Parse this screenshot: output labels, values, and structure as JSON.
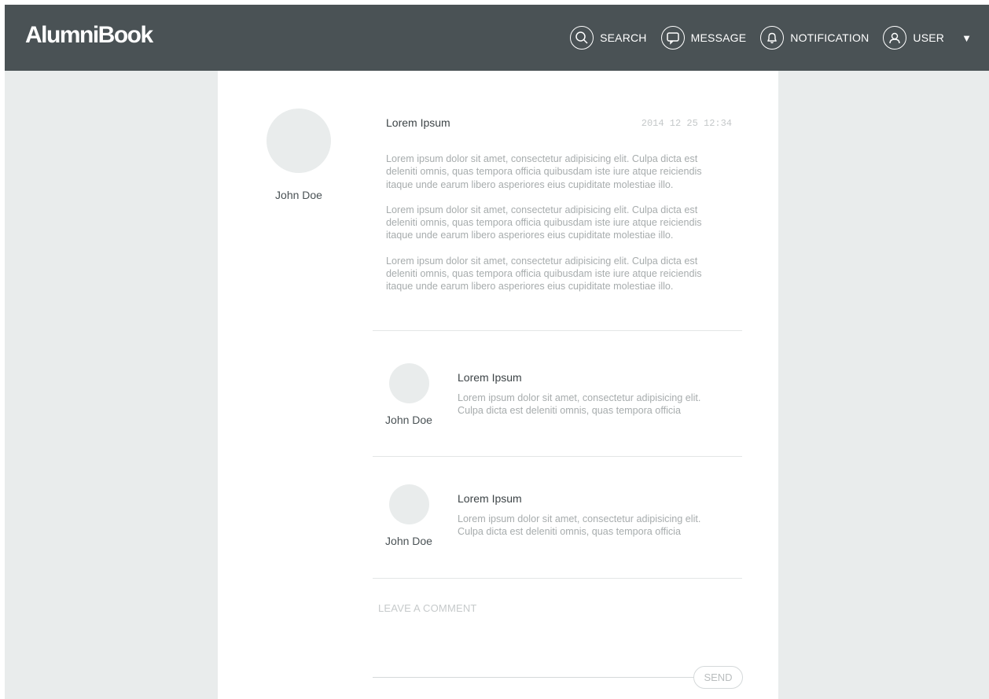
{
  "app": {
    "logo": "AlumniBook"
  },
  "nav": {
    "items": [
      {
        "label": "SEARCH",
        "icon": "search-icon"
      },
      {
        "label": "MESSAGE",
        "icon": "message-icon"
      },
      {
        "label": "NOTIFICATION",
        "icon": "bell-icon"
      },
      {
        "label": "USER",
        "icon": "user-icon"
      }
    ],
    "dropdown_icon": "caret-down-icon"
  },
  "post": {
    "author": "John Doe",
    "title": "Lorem Ipsum",
    "timestamp": "2014 12 25 12:34",
    "paragraphs": [
      [
        "Lorem ipsum dolor sit amet, consectetur adipisicing elit. Culpa dicta est",
        "deleniti omnis, quas tempora officia quibusdam iste iure atque reiciendis",
        "itaque unde earum libero asperiores eius cupiditate molestiae illo."
      ],
      [
        "Lorem ipsum dolor sit amet, consectetur adipisicing elit. Culpa dicta est",
        "deleniti omnis, quas tempora officia quibusdam iste iure atque reiciendis",
        "itaque unde earum libero asperiores eius cupiditate molestiae illo."
      ],
      [
        "Lorem ipsum dolor sit amet, consectetur adipisicing elit. Culpa dicta est",
        "deleniti omnis, quas tempora officia quibusdam iste iure atque reiciendis",
        "itaque unde earum libero asperiores eius cupiditate molestiae illo."
      ]
    ]
  },
  "comments": [
    {
      "author": "John Doe",
      "title": "Lorem Ipsum",
      "lines": [
        "Lorem ipsum dolor sit amet, consectetur adipisicing elit.",
        "Culpa dicta est deleniti omnis, quas tempora officia"
      ]
    },
    {
      "author": "John Doe",
      "title": "Lorem Ipsum",
      "lines": [
        "Lorem ipsum dolor sit amet, consectetur adipisicing elit.",
        "Culpa dicta est deleniti omnis, quas tempora officia"
      ]
    }
  ],
  "comment_form": {
    "placeholder": "LEAVE A COMMENT",
    "send_label": "SEND"
  },
  "colors": {
    "topbar": "#4a5255",
    "background": "#e9ecec",
    "content": "#ffffff",
    "avatar": "#e9ecec",
    "body_text": "#a7acad"
  }
}
